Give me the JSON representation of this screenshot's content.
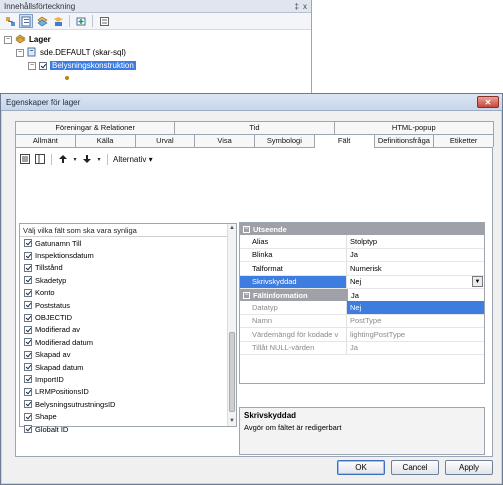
{
  "toc": {
    "title": "Innehållsförteckning",
    "pin_glyph": "‡",
    "close_glyph": "x",
    "tree": {
      "root_label": "Lager",
      "db_label": "sde.DEFAULT (skar-sql)",
      "layer_label": "Belysningskonstruktion",
      "expander_minus": "−"
    }
  },
  "dialog": {
    "title": "Egenskaper för lager",
    "close_glyph": "✕",
    "tabs_row1": [
      "Föreningar & Relationer",
      "Tid",
      "HTML-popup"
    ],
    "tabs_row2": [
      "Allmänt",
      "Källa",
      "Urval",
      "Visa",
      "Symbologi",
      "Fält",
      "Definitionsfråga",
      "Etiketter"
    ],
    "active_tab": "Fält",
    "toolbar": {
      "alternatives_label": "Alternativ ▾"
    },
    "field_list": {
      "header": "Välj vilka fält som ska vara synliga",
      "items": [
        "Gatunamn Till",
        "Inspektionsdatum",
        "Tillstånd",
        "Skadetyp",
        "Konto",
        "Poststatus",
        "OBJECTID",
        "Modifierad av",
        "Modifierad datum",
        "Skapad av",
        "Skapad datum",
        "ImportID",
        "LRMPositionsID",
        "BelysningsutrustningsID",
        "Shape",
        "Globalt ID"
      ]
    },
    "property_grid": {
      "cat1": "Utseende",
      "cat2": "Fältinformation",
      "rows_appearance": [
        {
          "key": "Alias",
          "value": "Stolptyp"
        },
        {
          "key": "Blinka",
          "value": "Ja"
        },
        {
          "key": "Talformat",
          "value": "Numerisk"
        },
        {
          "key": "Skrivskyddad",
          "value": "Nej"
        }
      ],
      "popup_value": "Ja",
      "rows_info": [
        {
          "key": "Datatyp",
          "value": "Nej"
        },
        {
          "key": "Namn",
          "value": "PostType"
        },
        {
          "key": "Värdemängd för kodade v",
          "value": "lightingPostType"
        },
        {
          "key": "Tillåt NULL-värden",
          "value": "Ja"
        }
      ]
    },
    "description": {
      "title": "Skrivskyddad",
      "text": "Avgör om fältet är redigerbart"
    },
    "buttons": {
      "ok": "OK",
      "cancel": "Cancel",
      "apply": "Apply"
    }
  }
}
